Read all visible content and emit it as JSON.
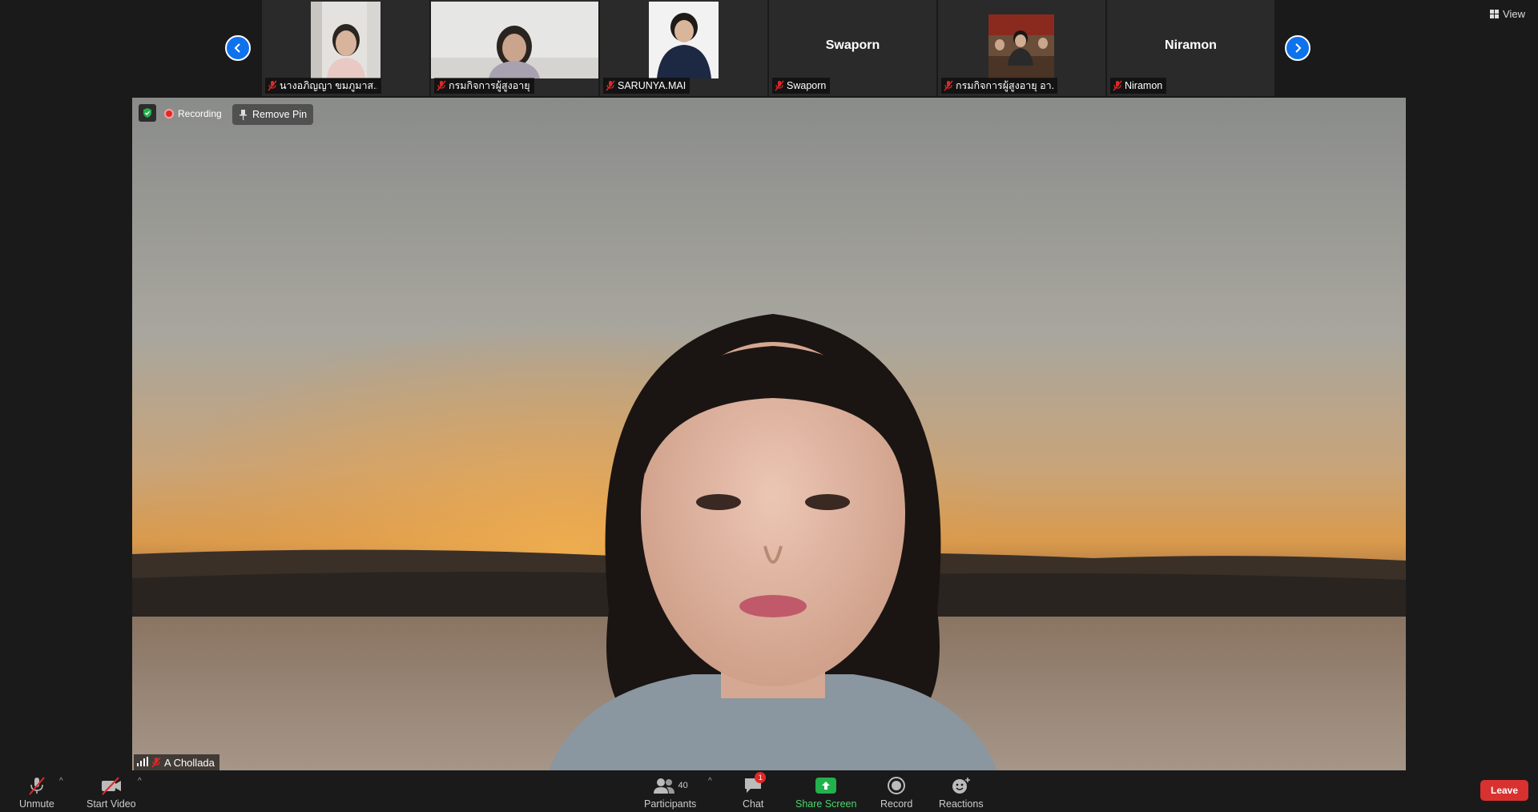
{
  "top": {
    "view_label": "View",
    "prev_icon": "chevron-left-icon",
    "next_icon": "chevron-right-icon"
  },
  "participants": [
    {
      "name": "นางอภิญญา ขมภูมาส...",
      "has_video": true,
      "muted": true
    },
    {
      "name": "กรมกิจการผู้สูงอายุ",
      "has_video": true,
      "muted": true
    },
    {
      "name": "SARUNYA.MAI",
      "has_video": true,
      "muted": true
    },
    {
      "name": "Swaporn",
      "center_label": "Swaporn",
      "has_video": false,
      "muted": true
    },
    {
      "name": "กรมกิจการผู้สูงอายุ อา...",
      "has_video": true,
      "muted": true
    },
    {
      "name": "Niramon",
      "center_label": "Niramon",
      "has_video": false,
      "muted": true
    }
  ],
  "main": {
    "recording_label": "Recording",
    "remove_pin_label": "Remove Pin",
    "speaker_name": "A Chollada"
  },
  "toolbar": {
    "unmute_label": "Unmute",
    "start_video_label": "Start Video",
    "participants_label": "Participants",
    "participants_count": "40",
    "chat_label": "Chat",
    "chat_badge": "1",
    "share_label": "Share Screen",
    "record_label": "Record",
    "reactions_label": "Reactions",
    "leave_label": "Leave"
  },
  "colors": {
    "accent_blue": "#0e72ed",
    "share_green": "#22b14c",
    "leave_red": "#d93030",
    "muted_red": "#e02828"
  }
}
